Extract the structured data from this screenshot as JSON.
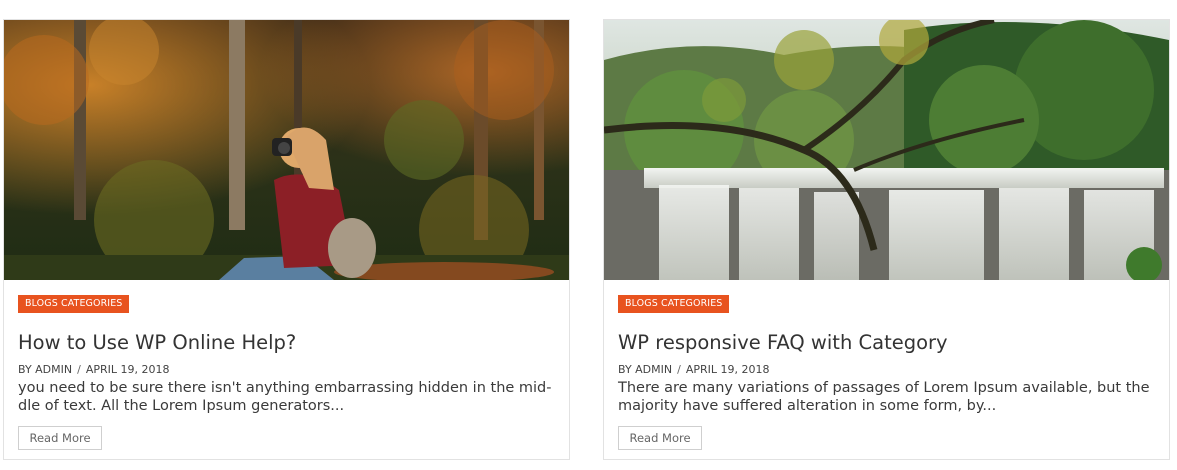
{
  "posts": [
    {
      "image": "forest-photographer-photo",
      "category": "BLOGS CATEGORIES",
      "title": "How to Use WP Online Help?",
      "author": "BY ADMIN",
      "separator": "/",
      "date": "APRIL 19, 2018",
      "excerpt": "you need to be sure there isn't anything embarrassing hidden in the mid-dle of text. All the Lorem Ipsum generators...",
      "read_more": "Read More"
    },
    {
      "image": "waterfall-photo",
      "category": "BLOGS CATEGORIES",
      "title": "WP responsive FAQ with Category",
      "author": "BY ADMIN",
      "separator": "/",
      "date": "APRIL 19, 2018",
      "excerpt": "There are many variations of passages of Lorem Ipsum available, but the majority have suffered alteration in some form, by...",
      "read_more": "Read More"
    }
  ],
  "colors": {
    "badge": "#e8531f",
    "title": "#333333",
    "border": "#e2e2e2"
  }
}
